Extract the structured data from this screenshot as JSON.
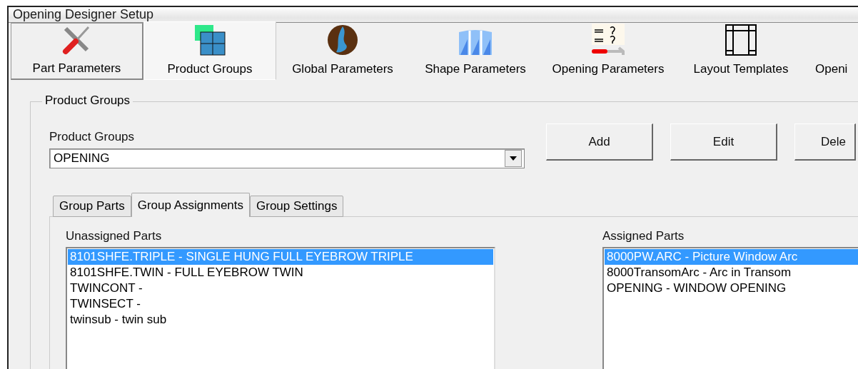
{
  "window": {
    "title": "Opening Designer Setup"
  },
  "toolbar_tabs": [
    {
      "label": "Part Parameters",
      "selected": false
    },
    {
      "label": "Product Groups",
      "selected": true
    },
    {
      "label": "Global Parameters",
      "selected": false
    },
    {
      "label": "Shape Parameters",
      "selected": false
    },
    {
      "label": "Opening Parameters",
      "selected": false
    },
    {
      "label": "Layout Templates",
      "selected": false
    },
    {
      "label": "Openi",
      "selected": false
    }
  ],
  "group_box": {
    "title": "Product Groups",
    "combo_label": "Product Groups",
    "combo_value": "OPENING",
    "buttons": [
      "Add",
      "Edit",
      "Dele"
    ],
    "tabs": [
      {
        "label": "Group Parts",
        "selected": false
      },
      {
        "label": "Group Assignments",
        "selected": true
      },
      {
        "label": "Group Settings",
        "selected": false
      }
    ],
    "unassigned": {
      "label": "Unassigned Parts",
      "items": [
        {
          "text": "8101SHFE.TRIPLE - SINGLE HUNG FULL EYEBROW TRIPLE",
          "selected": true
        },
        {
          "text": "8101SHFE.TWIN - FULL EYEBROW TWIN",
          "selected": false
        },
        {
          "text": "TWINCONT -",
          "selected": false
        },
        {
          "text": "TWINSECT -",
          "selected": false
        },
        {
          "text": "twinsub - twin sub",
          "selected": false
        }
      ]
    },
    "assigned": {
      "label": "Assigned Parts",
      "items": [
        {
          "text": "8000PW.ARC - Picture Window Arc",
          "selected": true
        },
        {
          "text": "8000TransomArc - Arc in Transom",
          "selected": false
        },
        {
          "text": "OPENING - WINDOW  OPENING",
          "selected": false
        }
      ]
    }
  }
}
